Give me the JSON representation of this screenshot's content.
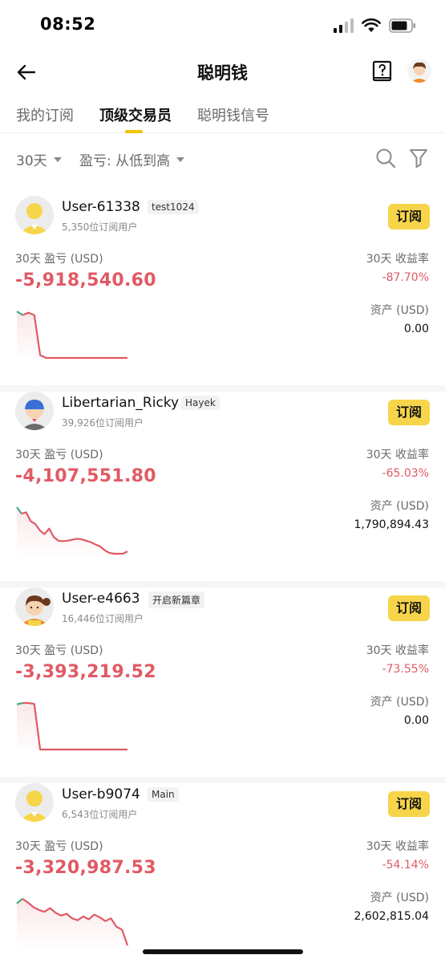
{
  "status_bar": {
    "time": "08:52"
  },
  "nav": {
    "title": "聪明钱"
  },
  "tabs": [
    {
      "label": "我的订阅"
    },
    {
      "label": "顶级交易员"
    },
    {
      "label": "聪明钱信号"
    }
  ],
  "filters": {
    "period": "30天",
    "sort": "盈亏: 从低到高"
  },
  "colors": {
    "accent": "#f7d54a",
    "loss": "#e05a64",
    "gain": "#3fae7c"
  },
  "traders": [
    {
      "name": "User-61338",
      "tag": "test1024",
      "subscribers": "5,350位订阅用户",
      "subscribe_label": "订阅",
      "pnl_label": "30天 盈亏 (USD)",
      "pnl": "-5,918,540.60",
      "roi_label": "30天 收益率",
      "roi": "-87.70%",
      "assets_label": "资产 (USD)",
      "assets": "0.00",
      "avatar_icon": "yellow-user-avatar-icon",
      "sparkline": [
        100,
        92,
        97,
        92,
        6,
        0,
        0,
        0,
        0,
        0,
        0,
        0,
        0,
        0,
        0,
        0,
        0,
        0,
        0,
        0
      ]
    },
    {
      "name": "Libertarian_Ricky",
      "tag": "Hayek",
      "subscribers": "39,926位订阅用户",
      "subscribe_label": "订阅",
      "pnl_label": "30天 盈亏 (USD)",
      "pnl": "-4,107,551.80",
      "roi_label": "30天 收益率",
      "roi": "-65.03%",
      "assets_label": "资产 (USD)",
      "assets": "1,790,894.43",
      "avatar_icon": "blue-cap-avatar-icon",
      "sparkline": [
        100,
        86,
        89,
        70,
        64,
        50,
        42,
        54,
        36,
        28,
        27,
        28,
        30,
        32,
        31,
        28,
        25,
        20,
        16,
        8,
        2,
        0,
        0,
        0,
        5
      ]
    },
    {
      "name": "User-e4663",
      "tag": "开启新篇章",
      "subscribers": "16,446位订阅用户",
      "subscribe_label": "订阅",
      "pnl_label": "30天 盈亏 (USD)",
      "pnl": "-3,393,219.52",
      "roi_label": "30天 收益率",
      "roi": "-73.55%",
      "assets_label": "资产 (USD)",
      "assets": "0.00",
      "avatar_icon": "ponytail-girl-avatar-icon",
      "sparkline": [
        97,
        100,
        100,
        98,
        0,
        0,
        0,
        0,
        0,
        0,
        0,
        0,
        0,
        0,
        0,
        0,
        0,
        0,
        0,
        0
      ]
    },
    {
      "name": "User-b9074",
      "tag": "Main",
      "subscribers": "6,543位订阅用户",
      "subscribe_label": "订阅",
      "pnl_label": "30天 盈亏 (USD)",
      "pnl": "-3,320,987.53",
      "roi_label": "30天 收益率",
      "roi": "-54.14%",
      "assets_label": "资产 (USD)",
      "assets": "2,602,815.04",
      "avatar_icon": "yellow-user-avatar-icon",
      "sparkline": [
        90,
        100,
        92,
        82,
        76,
        72,
        80,
        70,
        64,
        68,
        58,
        54,
        62,
        56,
        66,
        60,
        52,
        58,
        40,
        34,
        0
      ]
    }
  ]
}
